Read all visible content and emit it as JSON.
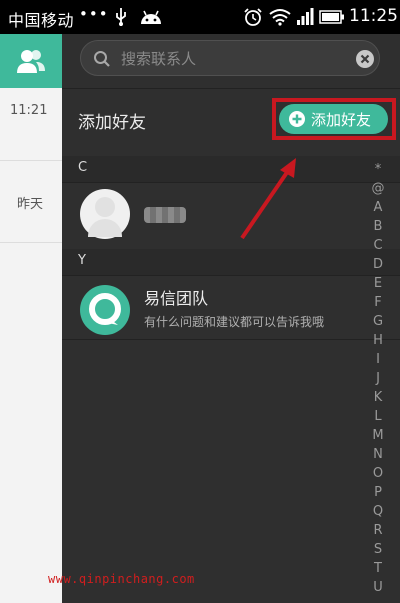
{
  "status_bar": {
    "carrier": "中国移动",
    "dots": "•••",
    "time": "11:25"
  },
  "left_strip": {
    "times": [
      "11:21",
      "昨天"
    ]
  },
  "search": {
    "placeholder": "搜索联系人"
  },
  "add_friend": {
    "title": "添加好友",
    "button_label": "添加好友"
  },
  "sections": [
    {
      "header": "C",
      "contacts": [
        {
          "name": "",
          "avatar": "default-avatar"
        }
      ]
    },
    {
      "header": "Y",
      "contacts": [
        {
          "name": "易信团队",
          "subtitle": "有什么问题和建议都可以告诉我哦",
          "avatar": "yixin-logo"
        }
      ]
    }
  ],
  "alphabet_index": [
    "*",
    "@",
    "A",
    "B",
    "C",
    "D",
    "E",
    "F",
    "G",
    "H",
    "I",
    "J",
    "K",
    "L",
    "M",
    "N",
    "O",
    "P",
    "Q",
    "R",
    "S",
    "T",
    "U"
  ],
  "watermark": "www.qinpinchang.com",
  "colors": {
    "accent": "#3fb99b",
    "panel_bg": "#2f2f2f",
    "highlight": "#c81820"
  }
}
